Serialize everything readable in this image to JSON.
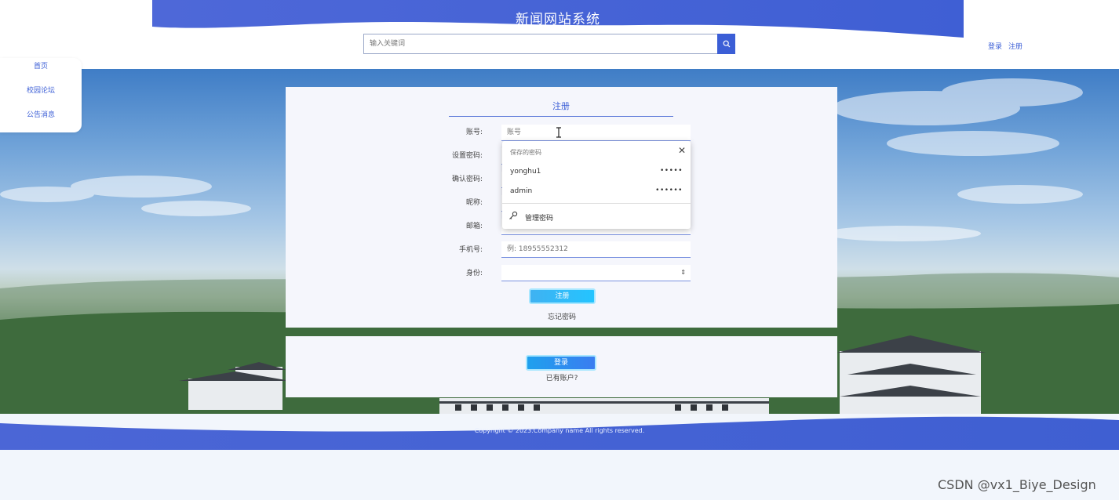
{
  "header": {
    "site_title": "新闻网站系统",
    "search_placeholder": "输入关键词",
    "login_link": "登录",
    "register_link": "注册"
  },
  "sidenav": {
    "items": [
      "首页",
      "校园论坛",
      "公告消息"
    ]
  },
  "register_form": {
    "title": "注册",
    "fields": [
      {
        "label": "账号:",
        "placeholder": "账号"
      },
      {
        "label": "设置密码:",
        "placeholder": ""
      },
      {
        "label": "确认密码:",
        "placeholder": ""
      },
      {
        "label": "昵称:",
        "placeholder": ""
      },
      {
        "label": "邮箱:",
        "placeholder": ""
      },
      {
        "label": "手机号:",
        "placeholder": "例: 18955552312"
      }
    ],
    "role_label": "身份:",
    "role_value": "",
    "submit_label": "注册",
    "forgot_label": "忘记密码"
  },
  "autofill": {
    "header": "保存的密码",
    "entries": [
      {
        "user": "yonghu1",
        "masked": "•••••"
      },
      {
        "user": "admin",
        "masked": "••••••"
      }
    ],
    "manage_label": "管理密码"
  },
  "login_section": {
    "login_label": "登录",
    "has_account_label": "已有账户?"
  },
  "footer": {
    "copyright": "Copyright © 2023.Company name All rights reserved."
  },
  "watermark": "CSDN @vx1_Biye_Design",
  "colors": {
    "primary": "#3b5ed6",
    "accent_blue": "#24c4ff"
  }
}
